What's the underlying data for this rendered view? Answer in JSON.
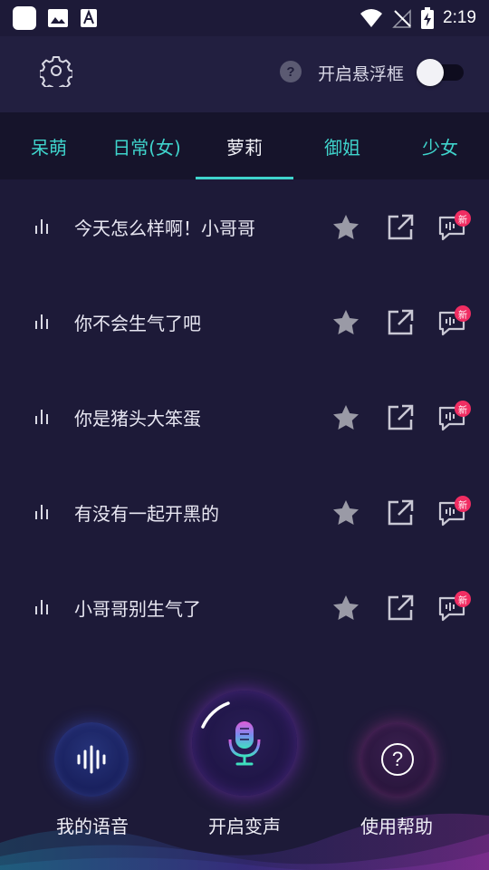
{
  "status_bar": {
    "time": "2:19",
    "left_icons": [
      "app-square-icon",
      "image-icon",
      "font-icon"
    ],
    "right_icons": [
      "wifi-icon",
      "no-signal-icon",
      "battery-charging-icon"
    ]
  },
  "header": {
    "settings_icon": "gear-icon",
    "help_icon_text": "?",
    "float_window_label": "开启悬浮框",
    "float_window_enabled": false
  },
  "tabs": [
    {
      "label": "呆萌",
      "active": false
    },
    {
      "label": "日常(女)",
      "active": false
    },
    {
      "label": "萝莉",
      "active": true
    },
    {
      "label": "御姐",
      "active": false
    },
    {
      "label": "少女",
      "active": false
    }
  ],
  "voice_items": [
    {
      "text": "今天怎么样啊！小哥哥",
      "badge": "新"
    },
    {
      "text": "你不会生气了吧",
      "badge": "新"
    },
    {
      "text": "你是猪头大笨蛋",
      "badge": "新"
    },
    {
      "text": "有没有一起开黑的",
      "badge": "新"
    },
    {
      "text": "小哥哥别生气了",
      "badge": "新"
    }
  ],
  "bottom": {
    "my_voice_label": "我的语音",
    "start_voice_label": "开启变声",
    "help_label": "使用帮助",
    "help_icon_text": "?"
  },
  "colors": {
    "accent": "#3fd4cc",
    "background": "#1d1a38",
    "badge": "#f02d62"
  }
}
